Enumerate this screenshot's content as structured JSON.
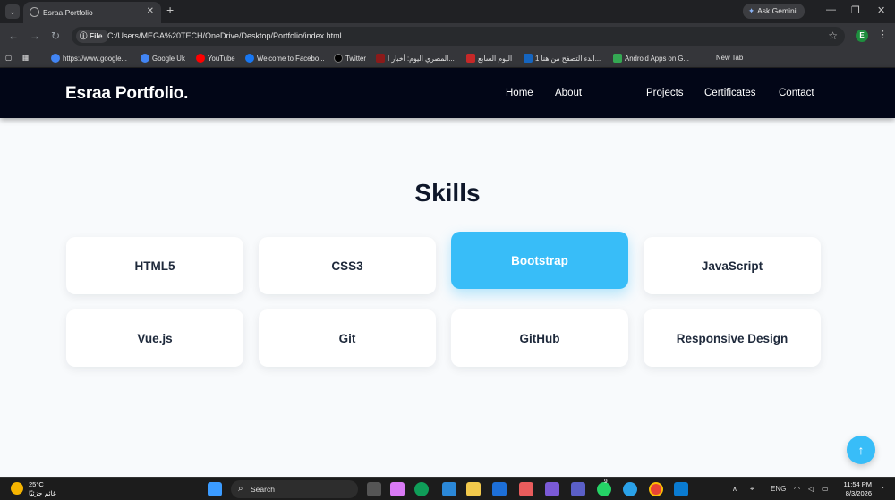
{
  "browser": {
    "tab_title": "Esraa Portfolio",
    "ask_gemini": "Ask Gemini",
    "address_chip": "File",
    "url": "C:/Users/MEGA%20TECH/OneDrive/Desktop/Portfolio/index.html",
    "profile_initial": "E",
    "bookmarks": [
      {
        "label": "https://www.google...",
        "icon": "google-icon",
        "color": "#4285f4"
      },
      {
        "label": "Google Uk",
        "icon": "google-icon",
        "color": "#4285f4"
      },
      {
        "label": "YouTube",
        "icon": "youtube-icon",
        "color": "#ff0000"
      },
      {
        "label": "Welcome to Facebo...",
        "icon": "facebook-icon",
        "color": "#1877f2"
      },
      {
        "label": "Twitter",
        "icon": "x-icon",
        "color": "#000000"
      },
      {
        "label": "المصري اليوم: أخبار ا...",
        "icon": "news-icon",
        "color": "#8b1a1a"
      },
      {
        "label": "اليوم السابع",
        "icon": "news-icon",
        "color": "#c62828"
      },
      {
        "label": "ابدء التصفح من هنا 1...",
        "icon": "page-icon",
        "color": "#1565c0"
      },
      {
        "label": "Android Apps on G...",
        "icon": "play-icon",
        "color": "#34a853"
      },
      {
        "label": "New Tab",
        "icon": "",
        "color": ""
      }
    ]
  },
  "site": {
    "logo": "Esraa Portfolio.",
    "nav": [
      "Home",
      "About",
      "Projects",
      "Certificates",
      "Contact"
    ],
    "section_title": "Skills",
    "skills": [
      "HTML5",
      "CSS3",
      "Bootstrap",
      "JavaScript",
      "Vue.js",
      "Git",
      "GitHub",
      "Responsive Design"
    ],
    "active_skill": "Bootstrap",
    "accent": "#38bdf8",
    "nav_bg": "#020617",
    "scroll_top": "↑"
  },
  "taskbar": {
    "temperature": "25°C",
    "weather_text": "غائم جزئيًا",
    "search": "Search",
    "language": "ENG",
    "time": "11:54 PM",
    "date": "8/3/2026",
    "whatsapp_badge": "9"
  }
}
